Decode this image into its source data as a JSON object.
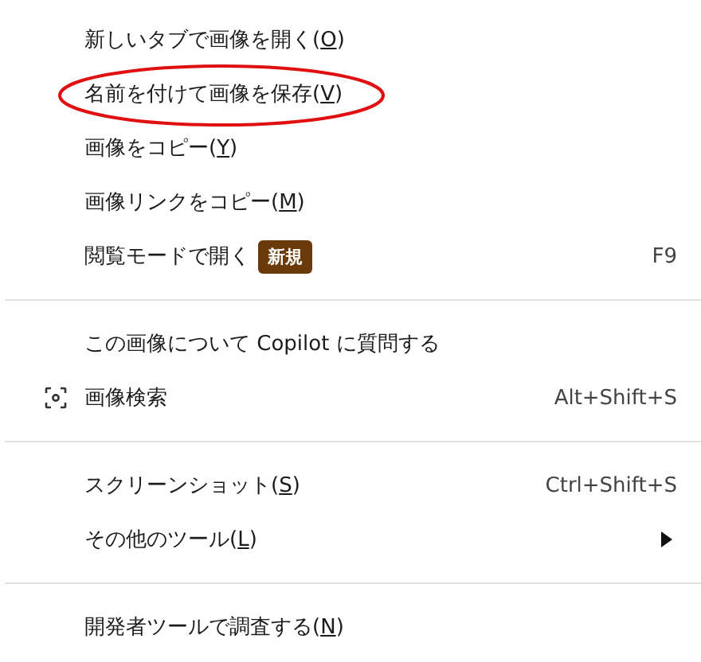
{
  "context_menu": {
    "sections": [
      {
        "items": [
          {
            "text": "新しいタブで画像を開く(",
            "access_key": "O",
            "text_end": ")"
          },
          {
            "text": "名前を付けて画像を保存(",
            "access_key": "V",
            "text_end": ")",
            "circled": true
          },
          {
            "text": "画像をコピー(",
            "access_key": "Y",
            "text_end": ")"
          },
          {
            "text": "画像リンクをコピー(",
            "access_key": "M",
            "text_end": ")"
          },
          {
            "text": "閲覧モードで開く",
            "badge": "新規",
            "shortcut": "F9"
          }
        ]
      },
      {
        "items": [
          {
            "text": "この画像について Copilot に質問する"
          },
          {
            "text": "画像検索",
            "shortcut": "Alt+Shift+S",
            "has_icon": true
          }
        ]
      },
      {
        "items": [
          {
            "text": "スクリーンショット(",
            "access_key": "S",
            "text_end": ")",
            "shortcut": "Ctrl+Shift+S"
          },
          {
            "text": "その他のツール(",
            "access_key": "L",
            "text_end": ")",
            "submenu": true
          }
        ]
      },
      {
        "items": [
          {
            "text": "開発者ツールで調査する(",
            "access_key": "N",
            "text_end": ")"
          }
        ]
      }
    ]
  }
}
